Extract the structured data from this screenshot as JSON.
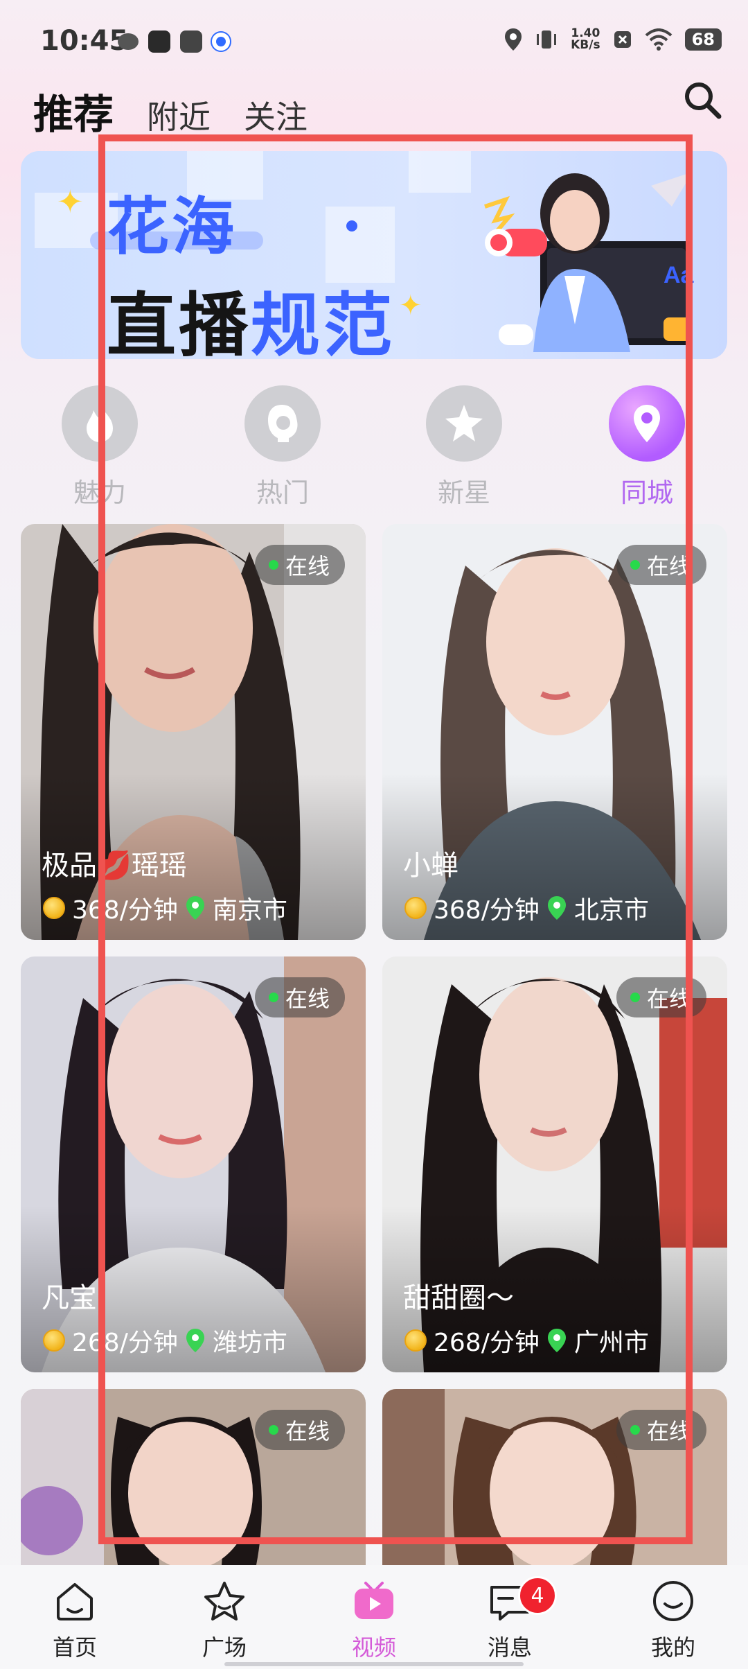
{
  "status_bar": {
    "time": "10:45",
    "network_speed_value": "1.40",
    "network_speed_unit": "KB/s",
    "battery": "68"
  },
  "top_tabs": [
    {
      "label": "推荐",
      "active": true
    },
    {
      "label": "附近",
      "active": false
    },
    {
      "label": "关注",
      "active": false
    }
  ],
  "banner": {
    "line1": "花海",
    "line2_black": "直播",
    "line2_blue": "规范",
    "illustration_text": "Aa"
  },
  "categories": [
    {
      "label": "魅力",
      "icon": "flame-icon",
      "active": false
    },
    {
      "label": "热门",
      "icon": "woman-silhouette-icon",
      "active": false
    },
    {
      "label": "新星",
      "icon": "star-icon",
      "active": false
    },
    {
      "label": "同城",
      "icon": "location-pin-icon",
      "active": true
    }
  ],
  "cards": [
    {
      "name": "极品💋瑶瑶",
      "status": "在线",
      "price": "368/分钟",
      "city": "南京市"
    },
    {
      "name": "小蝉",
      "status": "在线",
      "price": "368/分钟",
      "city": "北京市"
    },
    {
      "name": "凡宝",
      "status": "在线",
      "price": "268/分钟",
      "city": "潍坊市"
    },
    {
      "name": "甜甜圈～",
      "status": "在线",
      "price": "268/分钟",
      "city": "广州市"
    },
    {
      "name": "",
      "status": "在线",
      "price": "",
      "city": ""
    },
    {
      "name": "",
      "status": "在线",
      "price": "",
      "city": ""
    }
  ],
  "bottom_nav": [
    {
      "label": "首页",
      "icon": "home-icon",
      "active": false
    },
    {
      "label": "广场",
      "icon": "star-icon",
      "active": false
    },
    {
      "label": "视频",
      "icon": "video-icon",
      "active": true
    },
    {
      "label": "消息",
      "icon": "message-icon",
      "active": false,
      "badge": "4"
    },
    {
      "label": "我的",
      "icon": "smile-icon",
      "active": false
    }
  ],
  "colors": {
    "accent_purple": "#b167f0",
    "nav_active": "#d45ad8",
    "online_dot": "#27d94b",
    "banner_blue": "#3b63ff",
    "overlay_red": "#ef5350"
  }
}
